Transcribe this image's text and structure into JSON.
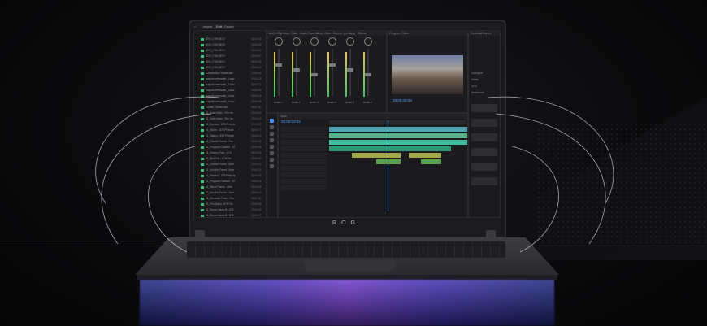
{
  "brand_text": "ROG",
  "app": {
    "menu_tabs": [
      "Import",
      "Edit",
      "Export"
    ],
    "panels": {
      "audio_clip_mixer": "Audio Clip Mixer: Ciclo",
      "audio_track_mixer": "Audio Track Mixer: Ciclo",
      "source": "Source: (no clips)",
      "effects": "Effects",
      "program": "Program: Ciclo",
      "essential_sound": "Essential Sound",
      "timeline": "Ciclo"
    },
    "timecode_program": "00:00:03:03",
    "timecode_timeline": "00:00:03:03",
    "files": [
      {
        "name": "SHO_0759.MOV",
        "dur": "00:00:16"
      },
      {
        "name": "SHO_0760.MOV",
        "dur": "00:00:09"
      },
      {
        "name": "SHO_0761.MOV",
        "dur": "00:00:11"
      },
      {
        "name": "SHO_0762.MOV",
        "dur": "00:00:07"
      },
      {
        "name": "SHO_0763.MOV",
        "dur": "00:00:05"
      },
      {
        "name": "SHO_0764.MOV",
        "dur": "00:00:12"
      },
      {
        "name": "Cobblestone.Street.wav",
        "dur": "00:00:44"
      },
      {
        "name": "magicfrozensarah_1.wav",
        "dur": "00:00:18"
      },
      {
        "name": "magicfrozensarah_2.wav",
        "dur": "00:00:21"
      },
      {
        "name": "magicfrozensarah_3.wav",
        "dur": "00:00:09"
      },
      {
        "name": "magicfrozensarah_4.wav",
        "dur": "00:00:14"
      },
      {
        "name": "magicfrozensarah_5.wav",
        "dur": "00:00:06"
      },
      {
        "name": "Cobble_Street.wav",
        "dur": "00:00:30"
      },
      {
        "name": "01_Both Sides - Fire Hu",
        "dur": "00:00:22"
      },
      {
        "name": "01_Both Sides - Fire Ho",
        "dur": "00:00:19"
      },
      {
        "name": "01_Bambra - 878 Prelude",
        "dur": "00:00:27"
      },
      {
        "name": "01_Stolen - 878 Prelude",
        "dur": "00:00:17"
      },
      {
        "name": "01_Raptor - 878 Prelude",
        "dur": "00:00:13"
      },
      {
        "name": "01_Double Frame - Fire",
        "dur": "00:00:25"
      },
      {
        "name": "01_Program Outdoor - 87",
        "dur": "00:00:08"
      },
      {
        "name": "01_Eskimo Phat - 87a",
        "dur": "00:00:16"
      },
      {
        "name": "01_Bird Fun - 878 Pre",
        "dur": "00:00:20"
      },
      {
        "name": "01_Double Frame - Amb",
        "dur": "00:00:11"
      },
      {
        "name": "01_Into the Forest - Amb",
        "dur": "00:00:24"
      },
      {
        "name": "01_Bambra - 878 Prelude",
        "dur": "00:00:09"
      },
      {
        "name": "01_Program Outdoor - 87",
        "dur": "00:00:14"
      },
      {
        "name": "01_Steve Frame - Amb",
        "dur": "00:00:18"
      },
      {
        "name": "01_Into the Forest - Amb",
        "dur": "00:00:12"
      },
      {
        "name": "01_Mountain Peak - Fire",
        "dur": "00:00:30"
      },
      {
        "name": "01_Fire Basin - 878 Pro",
        "dur": "00:00:06"
      },
      {
        "name": "01_Brown Hawk B - 878",
        "dur": "00:00:21"
      },
      {
        "name": "01_Brown Hawk B - 878",
        "dur": "00:00:17"
      }
    ],
    "mixer_channels": [
      "Audio 1",
      "Audio 2",
      "Audio 3",
      "Audio 4",
      "Audio 5",
      "Audio 6"
    ],
    "essential_sound_items": [
      "Dialogue",
      "Music",
      "SFX",
      "Ambience"
    ]
  }
}
